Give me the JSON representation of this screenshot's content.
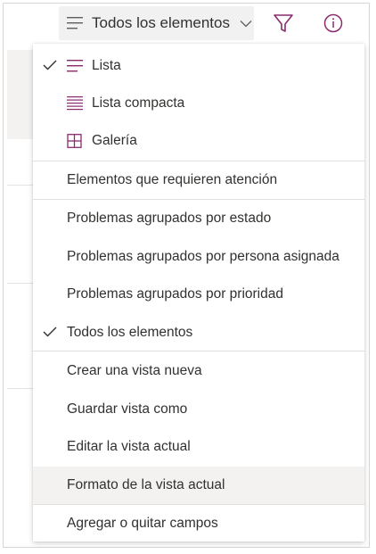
{
  "command_bar": {
    "view_label": "Todos los elementos",
    "view_icon": "list-lines-icon",
    "chevron_icon": "chevron-down-icon",
    "filter_icon": "filter-icon",
    "info_icon": "info-icon",
    "accent_color": "#8b2b6e"
  },
  "menu": {
    "layout_items": [
      {
        "label": "Lista",
        "icon": "list-icon",
        "checked": true
      },
      {
        "label": "Lista compacta",
        "icon": "compact-list-icon",
        "checked": false
      },
      {
        "label": "Galería",
        "icon": "gallery-icon",
        "checked": false
      }
    ],
    "attention_item": "Elementos que requieren atención",
    "view_items": [
      {
        "label": "Problemas agrupados por estado",
        "checked": false
      },
      {
        "label": "Problemas agrupados por persona asignada",
        "checked": false
      },
      {
        "label": "Problemas agrupados por prioridad",
        "checked": false
      },
      {
        "label": "Todos los elementos",
        "checked": true
      }
    ],
    "action_items": [
      {
        "label": "Crear una vista nueva"
      },
      {
        "label": "Guardar vista como"
      },
      {
        "label": "Editar la vista actual"
      },
      {
        "label": "Formato de la vista actual",
        "highlighted": true
      },
      {
        "label": "Agregar o quitar campos"
      }
    ]
  }
}
